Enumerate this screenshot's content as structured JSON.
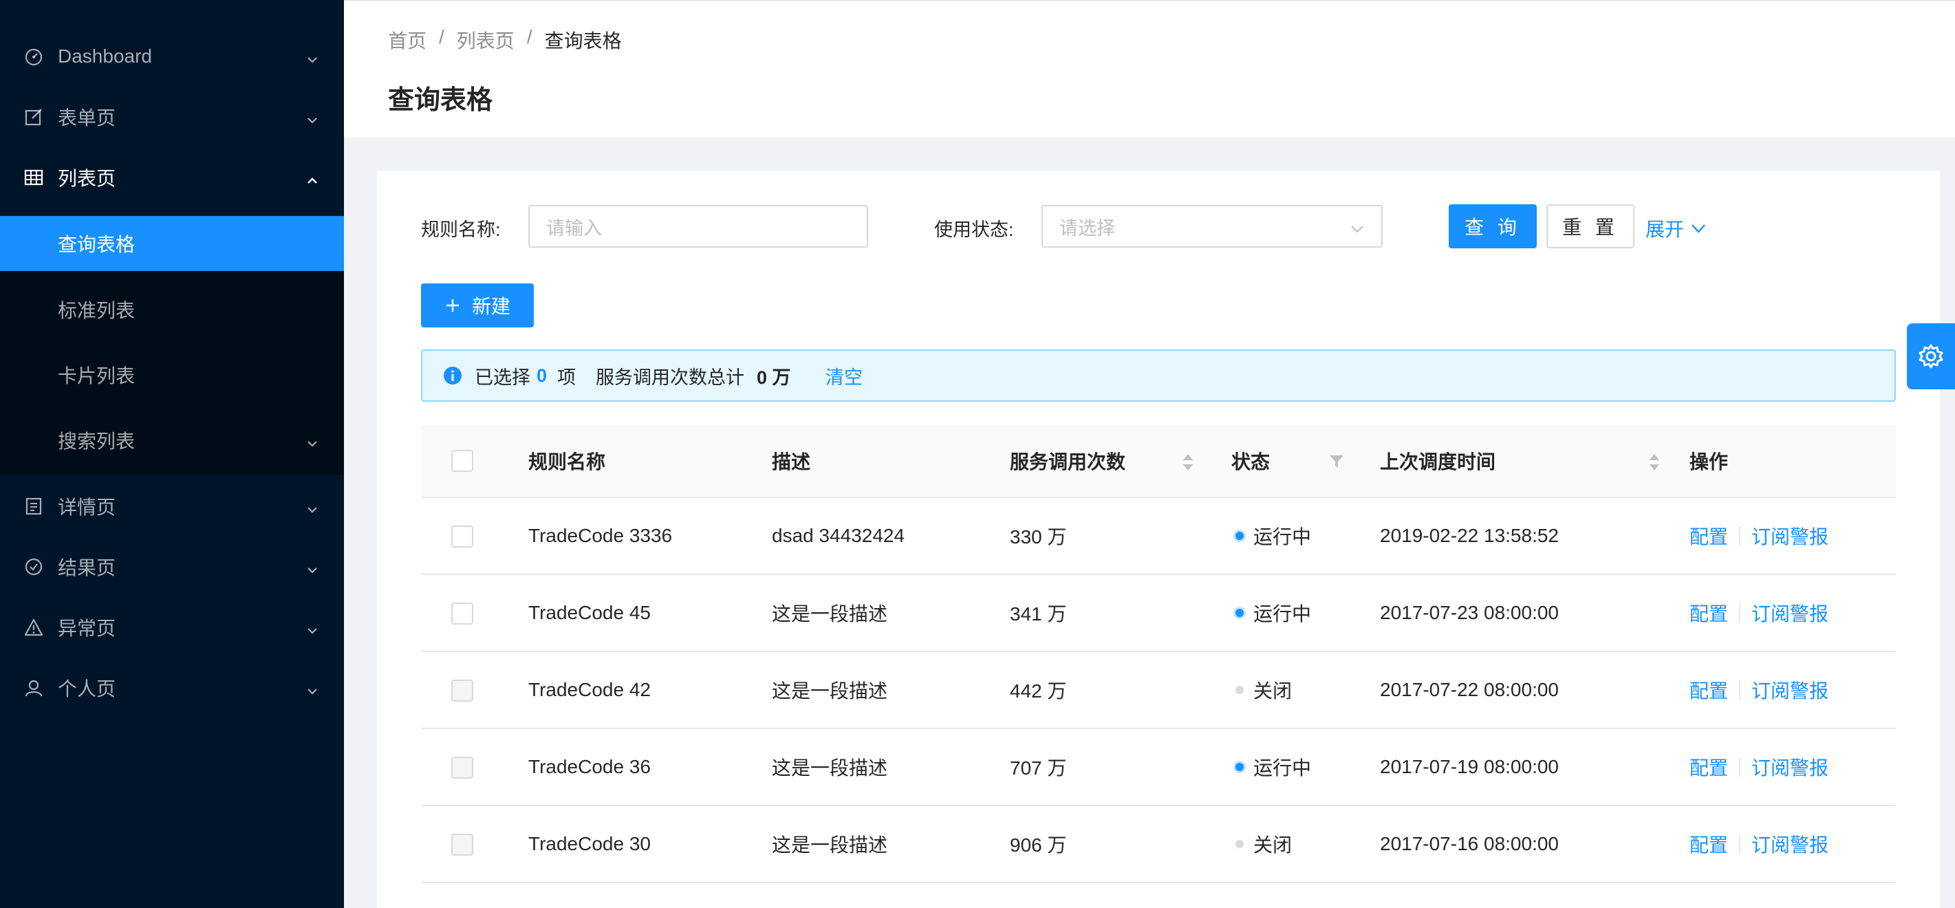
{
  "sidebar": {
    "items": [
      {
        "label": "Dashboard",
        "icon": "dashboard-icon"
      },
      {
        "label": "表单页",
        "icon": "form-icon"
      },
      {
        "label": "列表页",
        "icon": "table-icon"
      },
      {
        "label": "详情页",
        "icon": "profile-icon"
      },
      {
        "label": "结果页",
        "icon": "check-circle-icon"
      },
      {
        "label": "异常页",
        "icon": "warning-icon"
      },
      {
        "label": "个人页",
        "icon": "user-icon"
      }
    ],
    "submenu": [
      {
        "label": "查询表格",
        "selected": true
      },
      {
        "label": "标准列表"
      },
      {
        "label": "卡片列表"
      },
      {
        "label": "搜索列表"
      }
    ]
  },
  "breadcrumb": [
    "首页",
    "/",
    "列表页",
    "/",
    "查询表格"
  ],
  "page_title": "查询表格",
  "search_form": {
    "rule_name_label": "规则名称:",
    "rule_name_placeholder": "请输入",
    "status_label": "使用状态:",
    "status_placeholder": "请选择",
    "query_button": "查 询",
    "reset_button": "重 置",
    "expand_link": "展开"
  },
  "new_button": "新建",
  "alert": {
    "selected_prefix": "已选择",
    "selected_count": "0",
    "selected_suffix": "项",
    "total_prefix": "服务调用次数总计",
    "total_value": "0 万",
    "clear_link": "清空"
  },
  "table": {
    "columns": [
      "规则名称",
      "描述",
      "服务调用次数",
      "状态",
      "上次调度时间",
      "操作"
    ],
    "rows": [
      {
        "name": "TradeCode 3336",
        "desc": "dsad 34432424",
        "calls": "330 万",
        "status": "运行中",
        "status_color": "#1890ff",
        "time": "2019-02-22 13:58:52",
        "disabled": false
      },
      {
        "name": "TradeCode 45",
        "desc": "这是一段描述",
        "calls": "341 万",
        "status": "运行中",
        "status_color": "#1890ff",
        "time": "2017-07-23 08:00:00",
        "disabled": false
      },
      {
        "name": "TradeCode 42",
        "desc": "这是一段描述",
        "calls": "442 万",
        "status": "关闭",
        "status_color": "#d9d9d9",
        "time": "2017-07-22 08:00:00",
        "disabled": true
      },
      {
        "name": "TradeCode 36",
        "desc": "这是一段描述",
        "calls": "707 万",
        "status": "运行中",
        "status_color": "#1890ff",
        "time": "2017-07-19 08:00:00",
        "disabled": true
      },
      {
        "name": "TradeCode 30",
        "desc": "这是一段描述",
        "calls": "906 万",
        "status": "关闭",
        "status_color": "#d9d9d9",
        "time": "2017-07-16 08:00:00",
        "disabled": true
      }
    ],
    "action_config": "配置",
    "action_subscribe": "订阅警报"
  },
  "colors": {
    "sidebar": "#001529",
    "primary": "#1890ff"
  }
}
